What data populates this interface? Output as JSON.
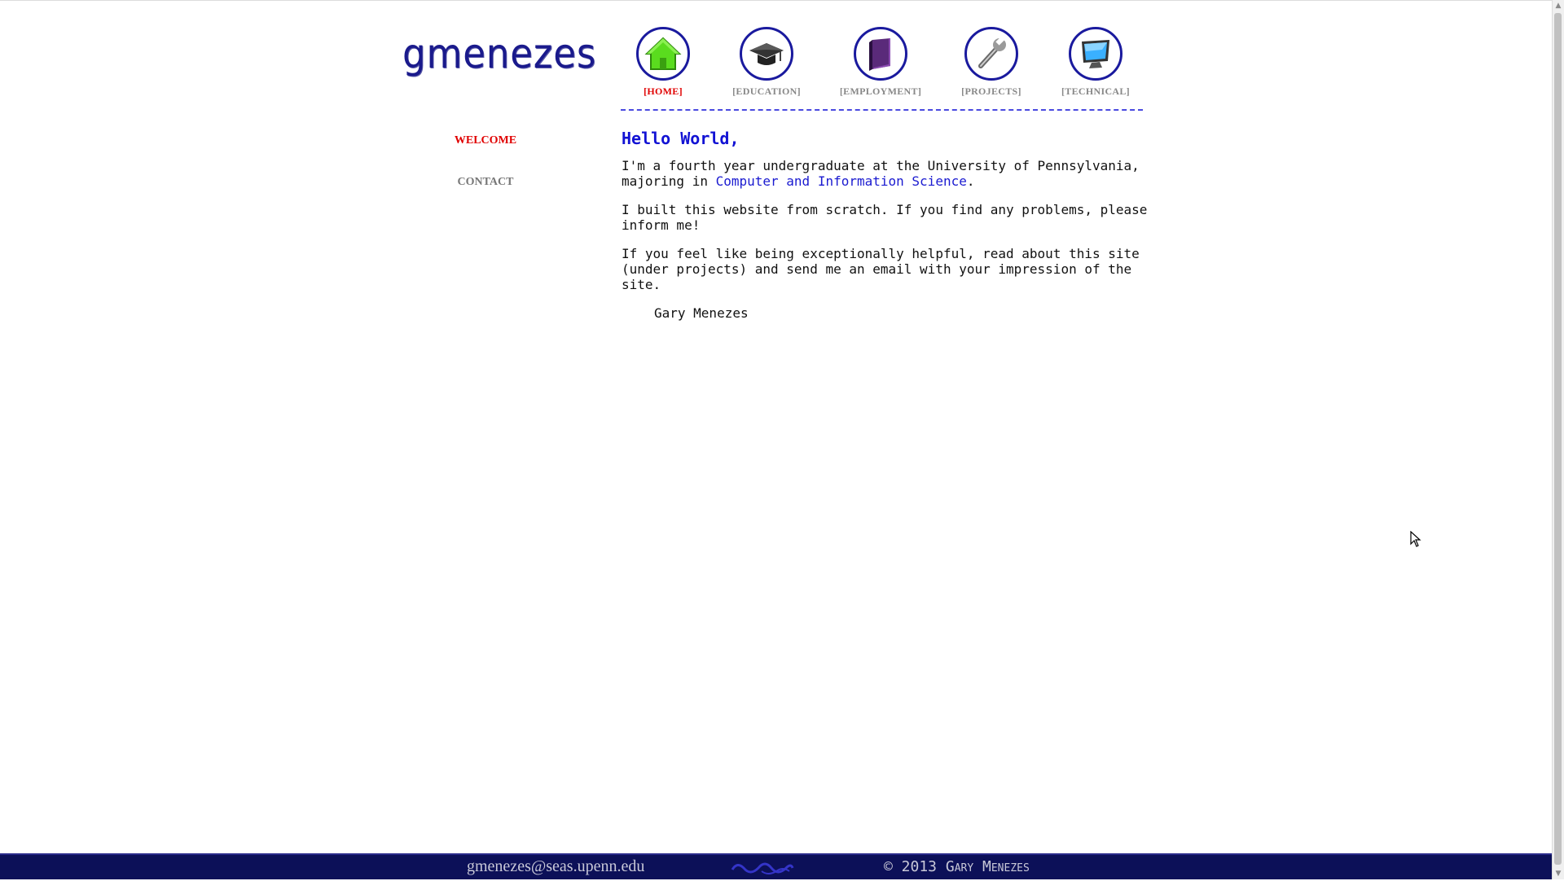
{
  "site": {
    "logo_text": "gmenezes"
  },
  "nav": {
    "items": [
      {
        "label": "[HOME]",
        "icon": "home-icon"
      },
      {
        "label": "[EDUCATION]",
        "icon": "graduation-cap-icon"
      },
      {
        "label": "[EMPLOYMENT]",
        "icon": "book-icon"
      },
      {
        "label": "[PROJECTS]",
        "icon": "wrench-icon"
      },
      {
        "label": "[TECHNICAL]",
        "icon": "monitor-icon"
      }
    ],
    "active": "[HOME]"
  },
  "sidebar": {
    "items": [
      {
        "label": "WELCOME",
        "active": true
      },
      {
        "label": "CONTACT",
        "active": false
      }
    ]
  },
  "content": {
    "greeting": "Hello World,",
    "para1_before": "I'm a fourth year undergraduate at the University of Pennsylvania, majoring in ",
    "para1_link": "Computer and Information Science",
    "para1_after": ".",
    "para2": "I built this website from scratch. If you find any problems, please inform me!",
    "para3": "If you feel like being exceptionally helpful, read about this site (under projects) and send me an email with your impression of the site.",
    "signature": "Gary Menezes"
  },
  "footer": {
    "email": "gmenezes@seas.upenn.edu",
    "copyright": "© 2013 Gary Menezes"
  },
  "colors": {
    "accent_blue": "#1212d4",
    "active_red": "#e00000",
    "footer_bg": "#0c1058"
  }
}
